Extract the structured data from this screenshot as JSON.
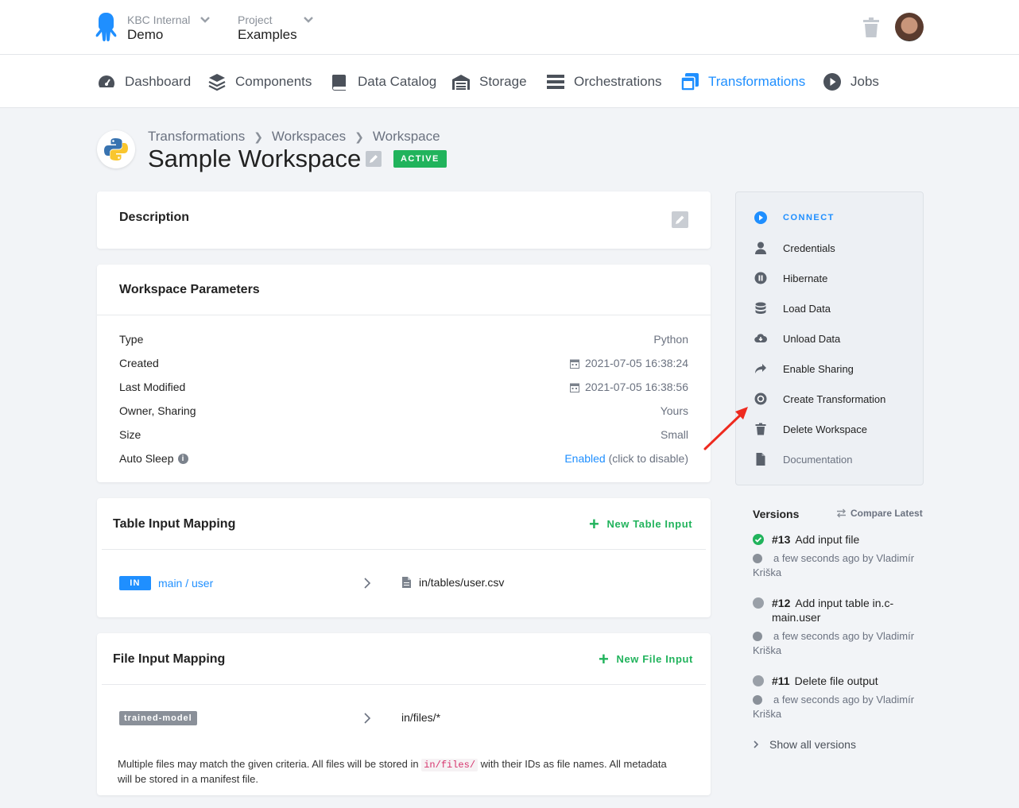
{
  "header": {
    "org_label": "KBC Internal",
    "org_name": "Demo",
    "project_label": "Project",
    "project_name": "Examples"
  },
  "nav": [
    {
      "label": "Dashboard",
      "icon": "gauge-icon"
    },
    {
      "label": "Components",
      "icon": "layers-icon"
    },
    {
      "label": "Data Catalog",
      "icon": "book-icon"
    },
    {
      "label": "Storage",
      "icon": "warehouse-icon"
    },
    {
      "label": "Orchestrations",
      "icon": "bars-icon"
    },
    {
      "label": "Transformations",
      "icon": "window-icon",
      "active": true
    },
    {
      "label": "Jobs",
      "icon": "play-circle-icon"
    }
  ],
  "breadcrumb": [
    "Transformations",
    "Workspaces",
    "Workspace"
  ],
  "page": {
    "title": "Sample Workspace",
    "status": "ACTIVE"
  },
  "description": {
    "title": "Description"
  },
  "parameters": {
    "title": "Workspace Parameters",
    "rows": [
      {
        "label": "Type",
        "value": "Python"
      },
      {
        "label": "Created",
        "value": "2021-07-05 16:38:24"
      },
      {
        "label": "Last Modified",
        "value": "2021-07-05 16:38:56"
      },
      {
        "label": "Owner, Sharing",
        "value": "Yours"
      },
      {
        "label": "Size",
        "value": "Small"
      },
      {
        "label": "Auto Sleep",
        "value_link": "Enabled",
        "value_rest": "(click to disable)"
      }
    ]
  },
  "table_input": {
    "title": "Table Input Mapping",
    "new_label": "New Table Input",
    "badge": "IN",
    "source": "main / user",
    "destination": "in/tables/user.csv"
  },
  "file_input": {
    "title": "File Input Mapping",
    "new_label": "New File Input",
    "tag": "trained-model",
    "destination": "in/files/*",
    "note_before": "Multiple files may match the given criteria. All files will be stored in",
    "note_code": "in/files/",
    "note_after": "with their IDs as file names. All metadata will be stored in a manifest file."
  },
  "sidebar": {
    "items": [
      {
        "label": "CONNECT",
        "icon": "play-circle-icon"
      },
      {
        "label": "Credentials",
        "icon": "user-icon"
      },
      {
        "label": "Hibernate",
        "icon": "pause-circle-icon"
      },
      {
        "label": "Load Data",
        "icon": "database-icon"
      },
      {
        "label": "Unload Data",
        "icon": "cloud-download-icon"
      },
      {
        "label": "Enable Sharing",
        "icon": "share-icon"
      },
      {
        "label": "Create Transformation",
        "icon": "gear-icon"
      },
      {
        "label": "Delete Workspace",
        "icon": "trash-icon"
      },
      {
        "label": "Documentation",
        "icon": "file-icon"
      }
    ]
  },
  "versions": {
    "title": "Versions",
    "compare_label": "Compare Latest",
    "items": [
      {
        "number": "#13",
        "title": "Add input file",
        "meta": "a few seconds ago by Vladimír Kriška",
        "current": true
      },
      {
        "number": "#12",
        "title": "Add input table in.c-main.user",
        "meta": "a few seconds ago by Vladimír Kriška",
        "current": false
      },
      {
        "number": "#11",
        "title": "Delete file output",
        "meta": "a few seconds ago by Vladimír Kriška",
        "current": false
      }
    ],
    "show_all": "Show all versions"
  },
  "colors": {
    "accent": "#1f8fff",
    "success": "#21b35c",
    "arrow": "#ee2a1f"
  }
}
